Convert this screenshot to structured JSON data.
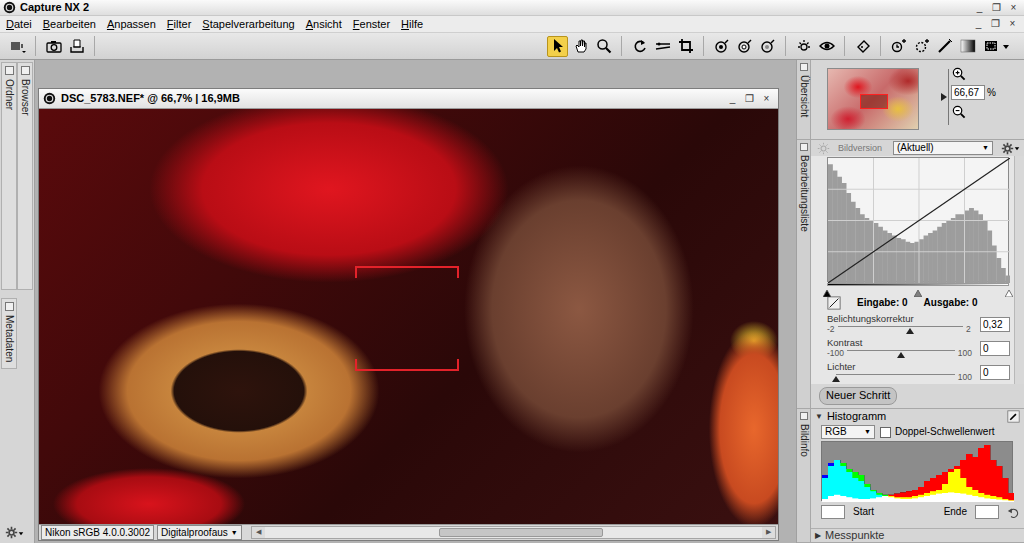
{
  "app": {
    "title": "Capture NX 2",
    "controls": [
      "_",
      "❐",
      "×"
    ]
  },
  "menu": [
    {
      "label": "Datei"
    },
    {
      "label": "Bearbeiten"
    },
    {
      "label": "Anpassen"
    },
    {
      "label": "Filter"
    },
    {
      "label": "Stapelverarbeitung"
    },
    {
      "label": "Ansicht"
    },
    {
      "label": "Fenster"
    },
    {
      "label": "Hilfe"
    }
  ],
  "mdi_controls": [
    "_",
    "❐",
    "×"
  ],
  "tools": [
    {
      "selected": true
    },
    {
      "selected": false
    },
    {
      "selected": false
    }
  ],
  "left_dock": [
    {
      "label": "Ordner"
    },
    {
      "label": "Browser"
    },
    {
      "label": "Metadaten"
    }
  ],
  "document": {
    "title": "DSC_5783.NEF* @ 66,7% | 16,9MB",
    "controls": [
      "_",
      "❐",
      "×"
    ],
    "focus_point": true,
    "profile": "Nikon sRGB 4.0.0.3002",
    "proof": "Digitalproofaus",
    "proof_arrow": "▼",
    "scroll": {
      "left_arrow": "◀",
      "right_arrow": "▶",
      "thumb_start": 0.35,
      "thumb_size": 0.33
    }
  },
  "right_dock": [
    {
      "label": "Übersicht"
    },
    {
      "label": "Bearbeitungsliste"
    },
    {
      "label": "Bildinfo"
    }
  ],
  "overview": {
    "zoom": "66,67",
    "unit": "%",
    "zoom_level": 0.5
  },
  "edit_list": {
    "version_label": "Bildversion",
    "version": "(Aktuell)",
    "version_arrow": "▼",
    "curve": {
      "histogram": [
        95,
        90,
        85,
        80,
        72,
        65,
        60,
        55,
        52,
        50,
        48,
        45,
        42,
        40,
        38,
        36,
        35,
        33,
        32,
        33,
        35,
        38,
        40,
        42,
        45,
        48,
        50,
        52,
        55,
        55,
        58,
        60,
        58,
        55,
        50,
        42,
        30,
        20,
        12,
        6
      ],
      "points": [
        [
          0,
          0
        ],
        [
          255,
          255
        ]
      ]
    },
    "levels": [
      {
        "level": 0,
        "color": "#000000"
      },
      {
        "level": 0.5,
        "color": "#808080"
      },
      {
        "level": 1,
        "color": "#ffffff"
      }
    ],
    "input_label": "Eingabe:",
    "input": "0",
    "output_label": "Ausgabe:",
    "output": "0",
    "sliders": [
      {
        "label": "Belichtungskorrektur",
        "min": "-2",
        "max": "2",
        "value": "0,32",
        "level": 0.58
      },
      {
        "label": "Kontrast",
        "min": "-100",
        "max": "100",
        "value": "0",
        "level": 0.5
      },
      {
        "label": "Lichter",
        "max": "100",
        "value": "0",
        "level": 0
      }
    ],
    "new_step": "Neuer Schritt"
  },
  "histogram": {
    "toggle": "▼",
    "expanded": true,
    "title": "Histogramm",
    "channel": "RGB",
    "channel_arrow": "▼",
    "double_threshold": {
      "label": "Doppel-Schwellenwert",
      "checked": false
    },
    "series": [
      {
        "color": "#ff0000",
        "values": [
          5,
          10,
          12,
          10,
          8,
          6,
          5,
          5,
          6,
          8,
          10,
          12,
          14,
          16,
          18,
          20,
          25,
          35,
          40,
          45,
          50,
          55,
          60,
          70,
          80,
          75,
          90,
          95,
          70,
          60,
          40,
          15
        ]
      },
      {
        "color": "#00ff00",
        "values": [
          40,
          60,
          70,
          65,
          55,
          50,
          45,
          30,
          20,
          15,
          12,
          10,
          8,
          8,
          8,
          10,
          12,
          15,
          18,
          20,
          30,
          50,
          55,
          40,
          25,
          20,
          15,
          12,
          10,
          8,
          5,
          3
        ]
      },
      {
        "color": "#0000ff",
        "values": [
          45,
          65,
          70,
          60,
          50,
          40,
          35,
          25,
          18,
          12,
          10,
          8,
          6,
          5,
          5,
          6,
          8,
          10,
          12,
          14,
          15,
          16,
          15,
          14,
          12,
          10,
          8,
          6,
          5,
          4,
          3,
          2
        ]
      }
    ],
    "start_label": "Start",
    "start": "",
    "end_label": "Ende",
    "end": ""
  },
  "measure_points": {
    "toggle": "▶",
    "expanded": false,
    "title": "Messpunkte"
  }
}
